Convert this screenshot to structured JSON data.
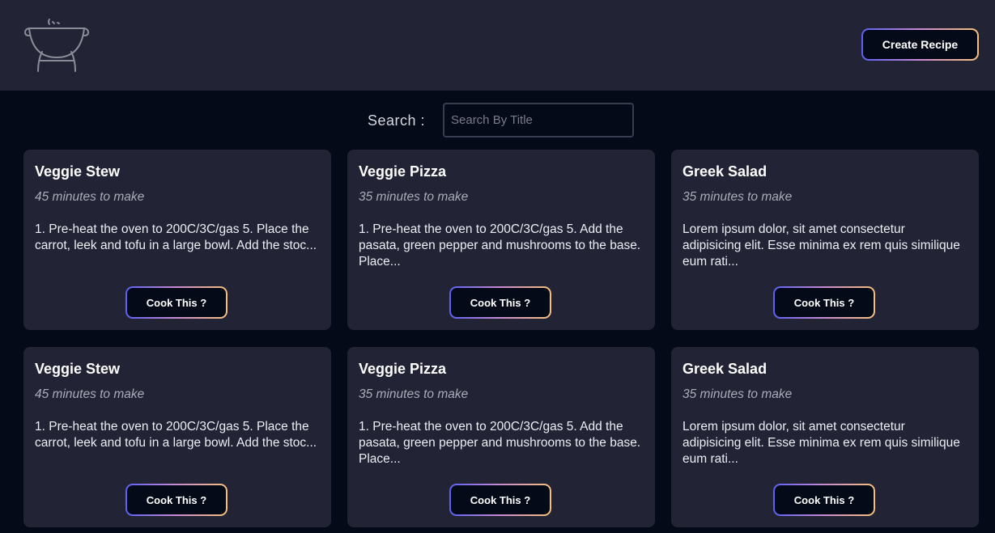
{
  "header": {
    "logo_icon": "grill-icon",
    "create_label": "Create Recipe"
  },
  "search": {
    "label": "Search :",
    "placeholder": "Search By Title",
    "value": ""
  },
  "cards": [
    {
      "title": "Veggie Stew",
      "time": "45 minutes to make",
      "description": "1. Pre-heat the oven to 200C/3C/gas 5. Place the carrot, leek and tofu in a large bowl. Add the stoc...",
      "button": "Cook This ?"
    },
    {
      "title": "Veggie Pizza",
      "time": "35 minutes to make",
      "description": "1. Pre-heat the oven to 200C/3C/gas 5. Add the pasata, green pepper and mushrooms to the base. Place...",
      "button": "Cook This ?"
    },
    {
      "title": "Greek Salad",
      "time": "35 minutes to make",
      "description": "Lorem ipsum dolor, sit amet consectetur adipisicing elit. Esse minima ex rem quis similique eum rati...",
      "button": "Cook This ?"
    },
    {
      "title": "Veggie Stew",
      "time": "45 minutes to make",
      "description": "1. Pre-heat the oven to 200C/3C/gas 5. Place the carrot, leek and tofu in a large bowl. Add the stoc...",
      "button": "Cook This ?"
    },
    {
      "title": "Veggie Pizza",
      "time": "35 minutes to make",
      "description": "1. Pre-heat the oven to 200C/3C/gas 5. Add the pasata, green pepper and mushrooms to the base. Place...",
      "button": "Cook This ?"
    },
    {
      "title": "Greek Salad",
      "time": "35 minutes to make",
      "description": "Lorem ipsum dolor, sit amet consectetur adipisicing elit. Esse minima ex rem quis similique eum rati...",
      "button": "Cook This ?"
    }
  ],
  "colors": {
    "header_bg": "#222436",
    "page_bg": "#050a18",
    "card_bg": "#222436",
    "gradient_start": "#5b61f5",
    "gradient_end": "#f5c07a"
  }
}
